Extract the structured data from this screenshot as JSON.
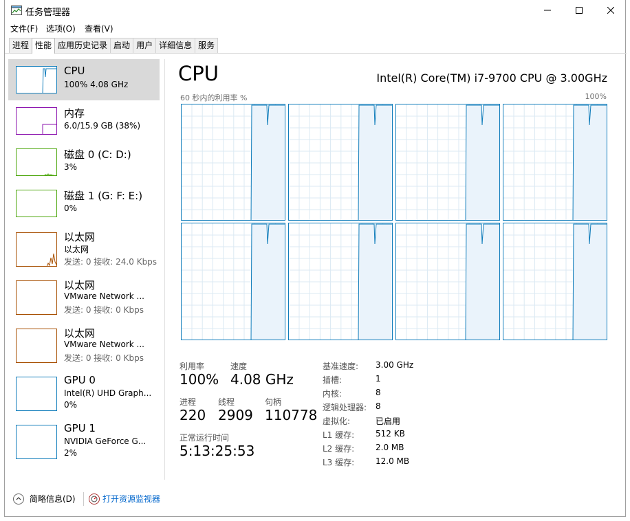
{
  "window": {
    "title": "任务管理器"
  },
  "menu": [
    "文件(F)",
    "选项(O)",
    "查看(V)"
  ],
  "tabs": [
    {
      "label": "进程",
      "active": false
    },
    {
      "label": "性能",
      "active": true
    },
    {
      "label": "应用历史记录",
      "active": false
    },
    {
      "label": "启动",
      "active": false
    },
    {
      "label": "用户",
      "active": false
    },
    {
      "label": "详细信息",
      "active": false
    },
    {
      "label": "服务",
      "active": false
    }
  ],
  "sidebar": {
    "items": [
      {
        "title": "CPU",
        "sub1": "100% 4.08 GHz",
        "color": "#117dbb",
        "selected": true
      },
      {
        "title": "内存",
        "sub1": "6.0/15.9 GB (38%)",
        "color": "#8b12ae"
      },
      {
        "title": "磁盘 0 (C: D:)",
        "sub1": "3%",
        "color": "#4da60c"
      },
      {
        "title": "磁盘 1 (G: F: E:)",
        "sub1": "0%",
        "color": "#4da60c"
      },
      {
        "title": "以太网",
        "sub1": "以太网",
        "sub2": "发送: 0 接收: 24.0 Kbps",
        "color": "#a74f01"
      },
      {
        "title": "以太网",
        "sub1": "VMware Network ...",
        "sub2": "发送: 0 接收: 0 Kbps",
        "color": "#a74f01"
      },
      {
        "title": "以太网",
        "sub1": "VMware Network ...",
        "sub2": "发送: 0 接收: 0 Kbps",
        "color": "#a74f01"
      },
      {
        "title": "GPU 0",
        "sub1": "Intel(R) UHD Graph...",
        "sub2": "0%",
        "color": "#117dbb"
      },
      {
        "title": "GPU 1",
        "sub1": "NVIDIA GeForce G...",
        "sub2": "2%",
        "color": "#117dbb"
      }
    ]
  },
  "main": {
    "title": "CPU",
    "model": "Intel(R) Core(TM) i7-9700 CPU @ 3.00GHz",
    "graph_label_left": "60 秒内的利用率 %",
    "graph_label_right": "100%",
    "core_count_shown": 8,
    "stats": {
      "util_label": "利用率",
      "util_value": "100%",
      "speed_label": "速度",
      "speed_value": "4.08 GHz",
      "proc_label": "进程",
      "proc_value": "220",
      "thread_label": "线程",
      "thread_value": "2909",
      "handle_label": "句柄",
      "handle_value": "110778",
      "uptime_label": "正常运行时间",
      "uptime_value": "5:13:25:53"
    },
    "specs": [
      {
        "k": "基准速度:",
        "v": "3.00 GHz"
      },
      {
        "k": "插槽:",
        "v": "1"
      },
      {
        "k": "内核:",
        "v": "8"
      },
      {
        "k": "逻辑处理器:",
        "v": "8"
      },
      {
        "k": "虚拟化:",
        "v": "已启用"
      },
      {
        "k": "L1 缓存:",
        "v": "512 KB"
      },
      {
        "k": "L2 缓存:",
        "v": "2.0 MB"
      },
      {
        "k": "L3 缓存:",
        "v": "12.0 MB"
      }
    ]
  },
  "footer": {
    "less_details": "简略信息(D)",
    "open_monitor": "打开资源监视器"
  },
  "colors": {
    "cpu": "#117dbb",
    "memory": "#8b12ae",
    "disk": "#4da60c",
    "ethernet": "#a74f01",
    "selected": "#d9d9d9"
  }
}
